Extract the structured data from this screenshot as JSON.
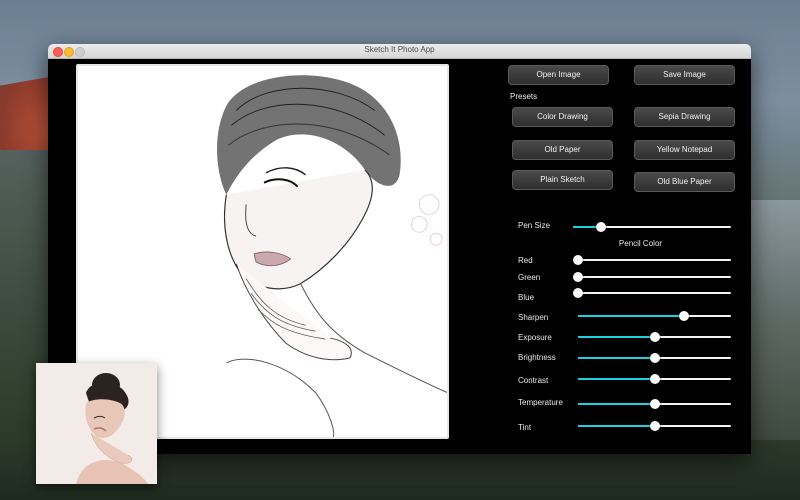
{
  "window": {
    "title": "Sketch It Photo App"
  },
  "buttons": {
    "open": "Open Image",
    "save": "Save Image"
  },
  "presets": {
    "heading": "Presets",
    "items": [
      "Color Drawing",
      "Sepia Drawing",
      "Old Paper",
      "Yellow Notepad",
      "Plain Sketch",
      "Old Blue Paper"
    ]
  },
  "controls": {
    "pen_size": {
      "label": "Pen Size",
      "value": 0.18
    },
    "pencil_color": {
      "heading": "Pencil Color",
      "red": {
        "label": "Red",
        "value": 0.0
      },
      "green": {
        "label": "Green",
        "value": 0.0
      },
      "blue": {
        "label": "Blue",
        "value": 0.0
      }
    },
    "sharpen": {
      "label": "Sharpen",
      "value": 0.69
    },
    "exposure": {
      "label": "Exposure",
      "value": 0.5
    },
    "brightness": {
      "label": "Brightness",
      "value": 0.5
    },
    "contrast": {
      "label": "Contrast",
      "value": 0.5
    },
    "temperature": {
      "label": "Temperature",
      "value": 0.5
    },
    "tint": {
      "label": "Tint",
      "value": 0.5
    }
  },
  "colors": {
    "accent": "#19d3e0",
    "track": "#f2f2f2",
    "window_bg": "#000000"
  }
}
